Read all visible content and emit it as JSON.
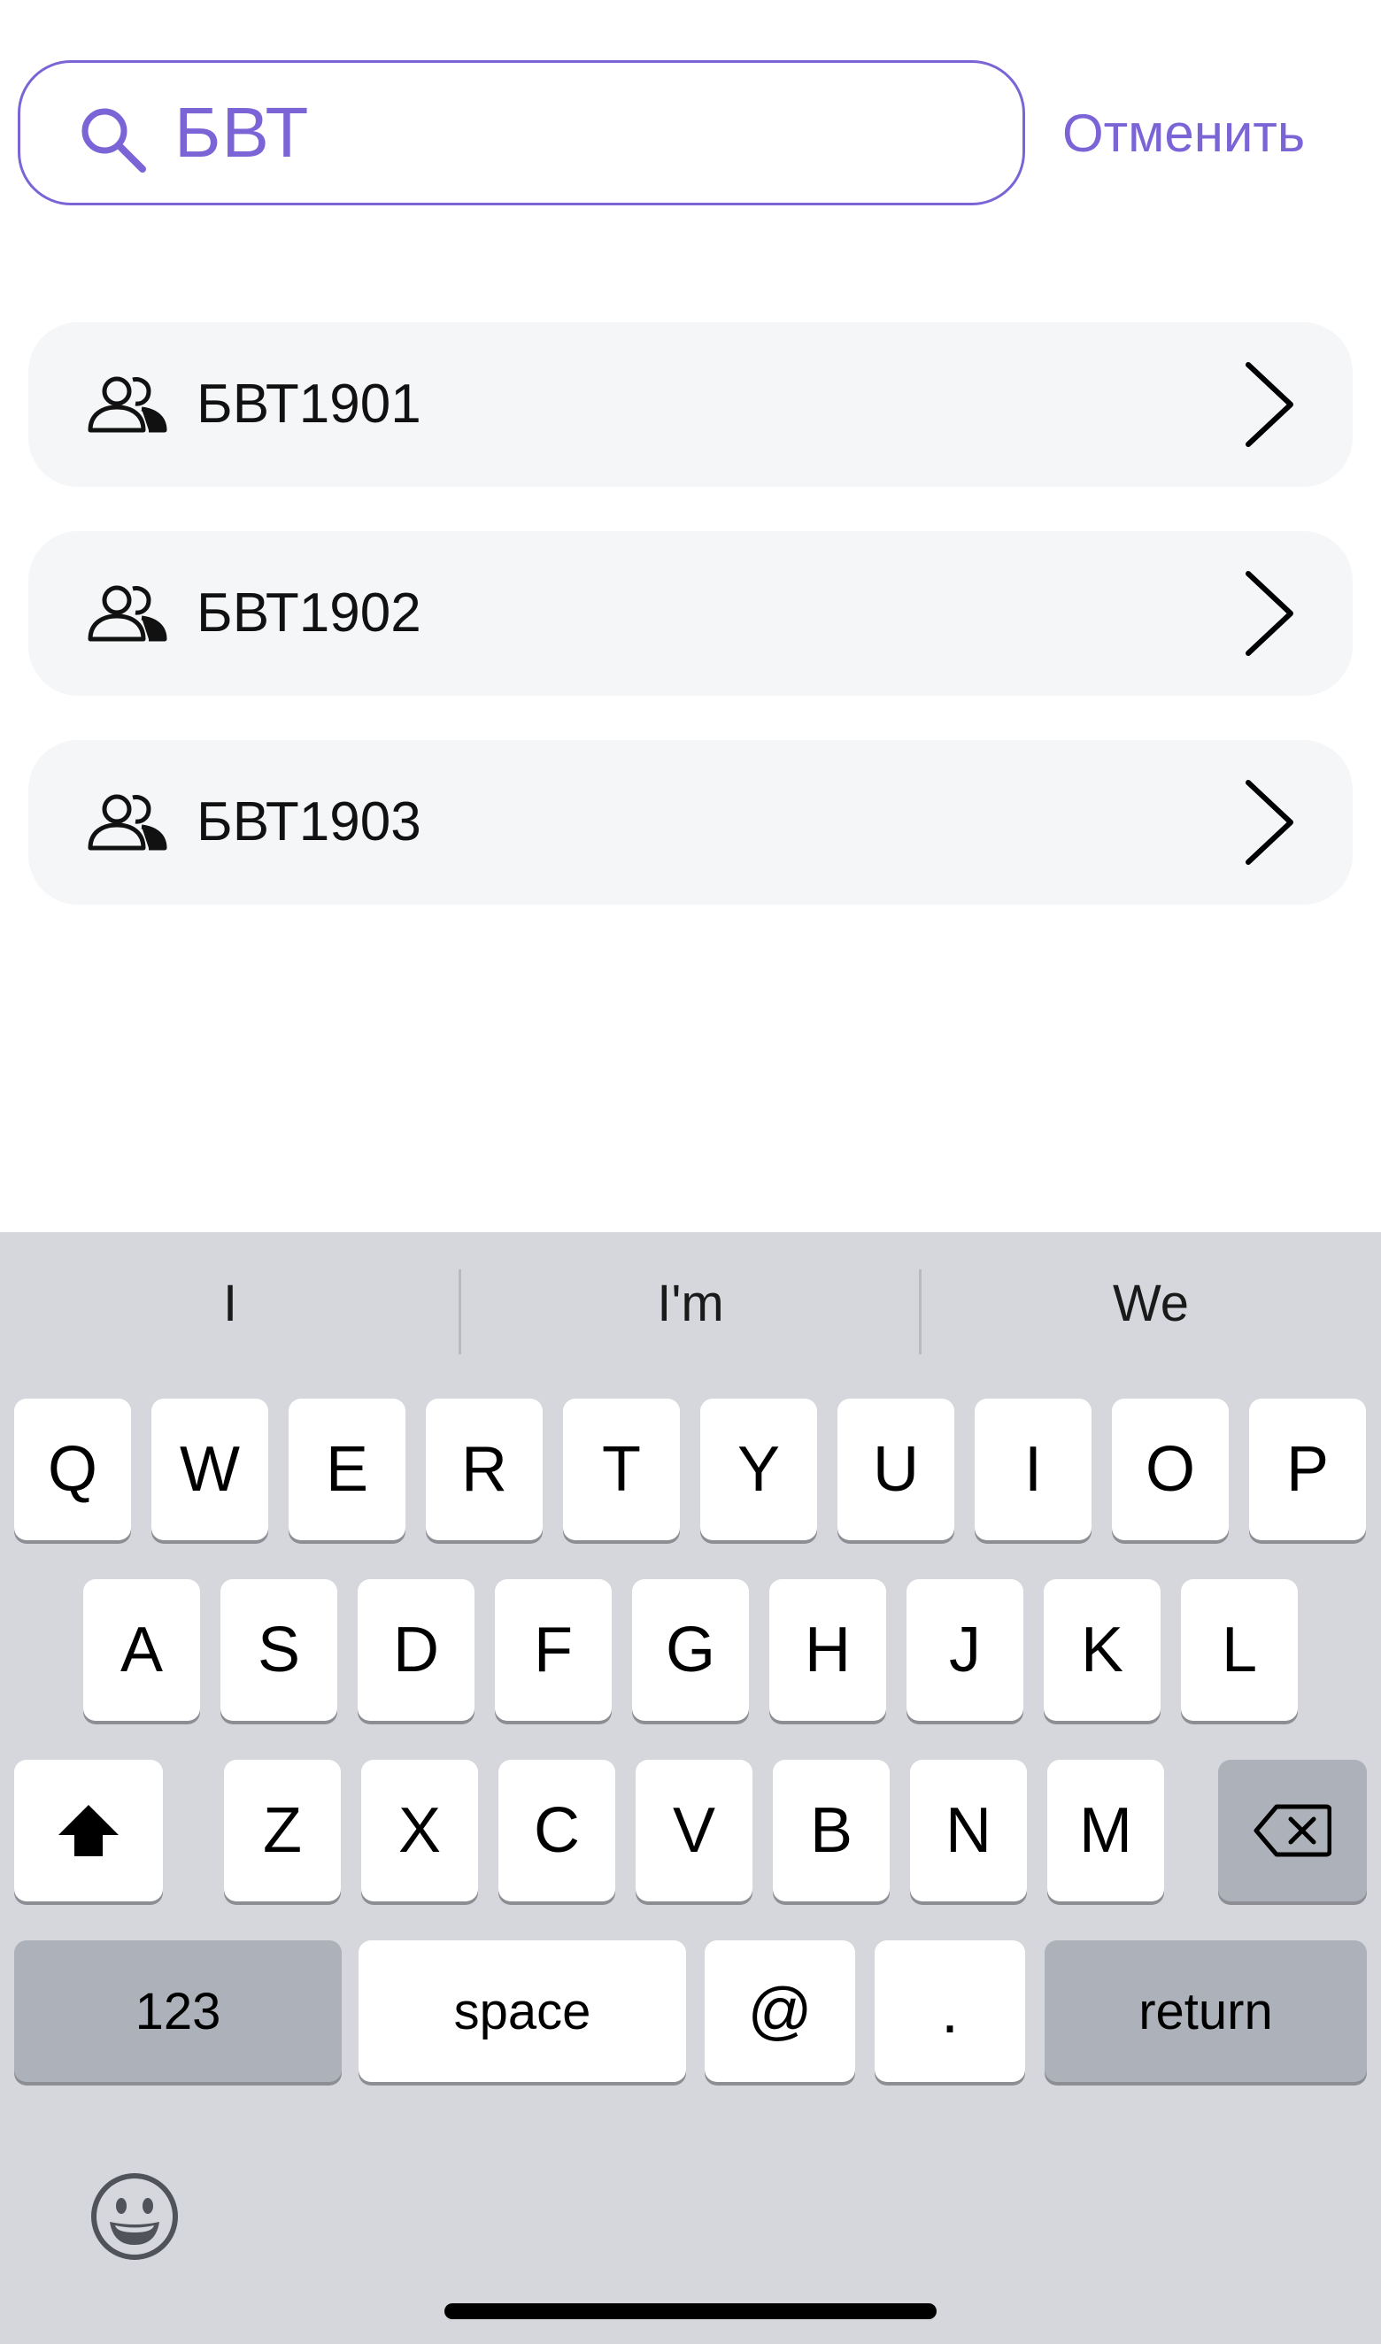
{
  "search": {
    "query": "БВТ",
    "cancel_label": "Отменить"
  },
  "results": [
    {
      "label": "БВТ1901"
    },
    {
      "label": "БВТ1902"
    },
    {
      "label": "БВТ1903"
    }
  ],
  "keyboard": {
    "suggestions": [
      "I",
      "I'm",
      "We"
    ],
    "row1": [
      "Q",
      "W",
      "E",
      "R",
      "T",
      "Y",
      "U",
      "I",
      "O",
      "P"
    ],
    "row2": [
      "A",
      "S",
      "D",
      "F",
      "G",
      "H",
      "J",
      "K",
      "L"
    ],
    "row3": [
      "Z",
      "X",
      "C",
      "V",
      "B",
      "N",
      "M"
    ],
    "numbers_label": "123",
    "space_label": "space",
    "at_label": "@",
    "period_label": ".",
    "return_label": "return"
  },
  "colors": {
    "accent": "#7b65d6",
    "card_background": "#f5f6f8",
    "keyboard_background": "#d5d7dc",
    "key_dark": "#adb1ba"
  },
  "icons": {
    "search": "search-icon",
    "group": "users-icon",
    "chevron": "chevron-right-icon",
    "shift": "shift-icon",
    "backspace": "backspace-icon",
    "emoji": "emoji-icon"
  }
}
